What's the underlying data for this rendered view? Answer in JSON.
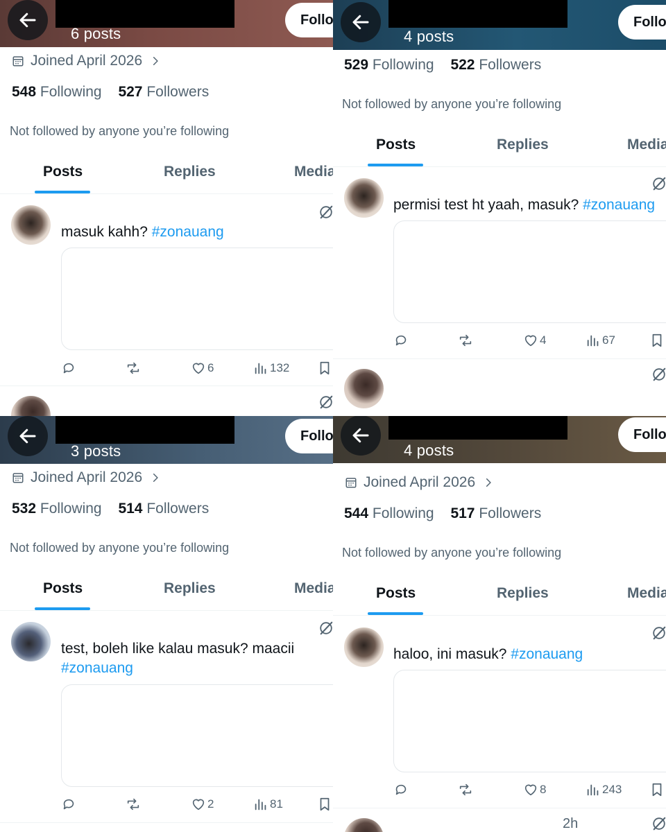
{
  "panels": [
    {
      "posts_count": "6 posts",
      "follow_label": "Follo",
      "joined": "Joined April 2026",
      "following_count": "548",
      "following_label": "Following",
      "followers_count": "527",
      "followers_label": "Followers",
      "not_followed": "Not followed by anyone you’re following",
      "tabs": [
        "Posts",
        "Replies",
        "Media"
      ],
      "tweet": {
        "text": "masuk kahh?",
        "hashtag": "#zonauang",
        "likes": "6",
        "views": "132"
      }
    },
    {
      "posts_count": "4 posts",
      "follow_label": "Follo",
      "following_count": "529",
      "following_label": "Following",
      "followers_count": "522",
      "followers_label": "Followers",
      "not_followed": "Not followed by anyone you’re following",
      "tabs": [
        "Posts",
        "Replies",
        "Media"
      ],
      "tweet": {
        "text": "permisi test ht yaah, masuk?",
        "hashtag": "#zonauang",
        "likes": "4",
        "views": "67"
      }
    },
    {
      "posts_count": "3 posts",
      "follow_label": "Follo",
      "joined": "Joined April 2026",
      "following_count": "532",
      "following_label": "Following",
      "followers_count": "514",
      "followers_label": "Followers",
      "not_followed": "Not followed by anyone you’re following",
      "tabs": [
        "Posts",
        "Replies",
        "Media"
      ],
      "tweet": {
        "text": "test, boleh like kalau masuk? maacii",
        "hashtag": "#zonauang",
        "likes": "2",
        "views": "81"
      }
    },
    {
      "posts_count": "4 posts",
      "follow_label": "Follo",
      "joined": "Joined April 2026",
      "following_count": "544",
      "following_label": "Following",
      "followers_count": "517",
      "followers_label": "Followers",
      "not_followed": "Not followed by anyone you’re following",
      "tabs": [
        "Posts",
        "Replies",
        "Media"
      ],
      "tweet": {
        "text": "haloo, ini masuk?",
        "hashtag": "#zonauang",
        "likes": "8",
        "views": "243"
      },
      "next_post_time": "2h"
    }
  ],
  "icons": {
    "back": "arrow-left-icon",
    "calendar": "calendar-icon",
    "chevron": "chevron-right-icon",
    "grok": "grok-icon",
    "reply": "reply-icon",
    "repost": "repost-icon",
    "like": "heart-icon",
    "views": "views-icon",
    "bookmark": "bookmark-icon"
  },
  "colors": {
    "accent": "#1d9bf0",
    "text_primary": "#0f1419",
    "text_secondary": "#536471"
  }
}
